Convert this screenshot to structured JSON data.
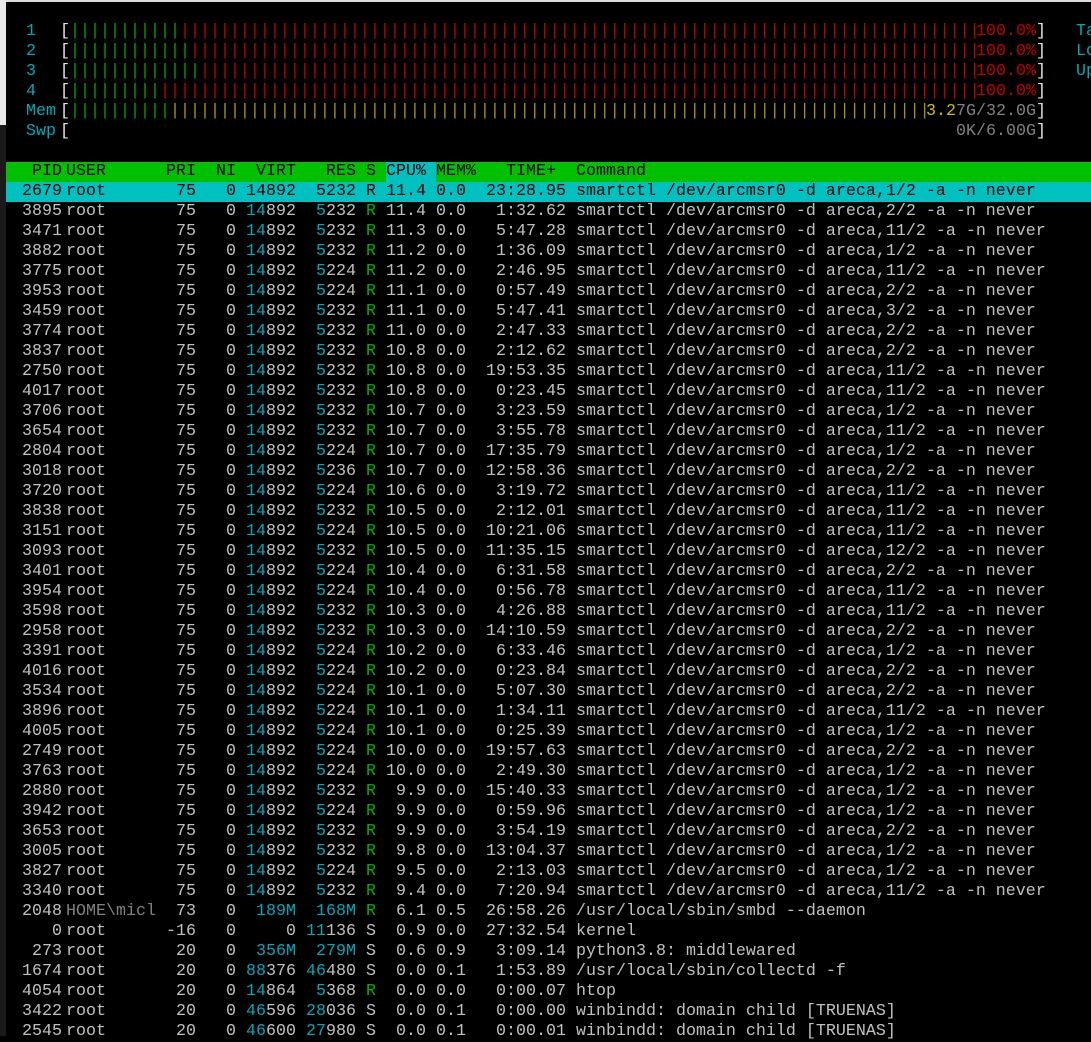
{
  "colors": {
    "header_bg": "#00c000",
    "selected_bg": "#00c0c0",
    "sort_column_bg": "#00c0c0",
    "cpu_normal": "#00a000",
    "cpu_kernel": "#c00000",
    "mem_used": "#00a000",
    "mem_cache": "#a09800",
    "label": "#00a8b8"
  },
  "meters": {
    "cpus": [
      {
        "label": "1",
        "normal_pct": 11.3,
        "kernel_pct": 88.7,
        "value": "100.0%"
      },
      {
        "label": "2",
        "normal_pct": 12.4,
        "kernel_pct": 87.6,
        "value": "100.0%"
      },
      {
        "label": "3",
        "normal_pct": 13.4,
        "kernel_pct": 86.6,
        "value": "100.0%"
      },
      {
        "label": "4",
        "normal_pct": 9.3,
        "kernel_pct": 90.7,
        "value": "100.0%"
      }
    ],
    "mem": {
      "label": "Mem",
      "used_pct": 10.2,
      "cache_pct": 89.8,
      "value_hi": "3.2",
      "value_rest": "7G/32.0G"
    },
    "swp": {
      "label": "Swp",
      "used_pct": 0,
      "value": "0K/6.00G"
    },
    "open_bracket": "[",
    "close_bracket": "]",
    "right_panel": [
      "Ta",
      "Lo",
      "Up"
    ]
  },
  "processes": {
    "columns": {
      "pid": "PID",
      "user": "USER",
      "pri": "PRI",
      "ni": "NI",
      "virt": "VIRT",
      "res": "RES",
      "s": "S",
      "cpu": "CPU%",
      "mem": "MEM%",
      "time": "TIME+",
      "cmd": "Command"
    },
    "sort_column": "CPU%",
    "selected_index": 0,
    "rows": [
      {
        "pid": "2679",
        "user": "root",
        "pri": "75",
        "ni": "0",
        "virt": "14892",
        "res": "5232",
        "s": "R",
        "cpu": "11.4",
        "mem": "0.0",
        "time": "23:28.95",
        "cmd": "smartctl /dev/arcmsr0 -d areca,1/2 -a -n never"
      },
      {
        "pid": "3895",
        "user": "root",
        "pri": "75",
        "ni": "0",
        "virt": "14892",
        "res": "5232",
        "s": "R",
        "cpu": "11.4",
        "mem": "0.0",
        "time": "1:32.62",
        "cmd": "smartctl /dev/arcmsr0 -d areca,2/2 -a -n never"
      },
      {
        "pid": "3471",
        "user": "root",
        "pri": "75",
        "ni": "0",
        "virt": "14892",
        "res": "5232",
        "s": "R",
        "cpu": "11.3",
        "mem": "0.0",
        "time": "5:47.28",
        "cmd": "smartctl /dev/arcmsr0 -d areca,11/2 -a -n never"
      },
      {
        "pid": "3882",
        "user": "root",
        "pri": "75",
        "ni": "0",
        "virt": "14892",
        "res": "5232",
        "s": "R",
        "cpu": "11.2",
        "mem": "0.0",
        "time": "1:36.09",
        "cmd": "smartctl /dev/arcmsr0 -d areca,1/2 -a -n never"
      },
      {
        "pid": "3775",
        "user": "root",
        "pri": "75",
        "ni": "0",
        "virt": "14892",
        "res": "5224",
        "s": "R",
        "cpu": "11.2",
        "mem": "0.0",
        "time": "2:46.95",
        "cmd": "smartctl /dev/arcmsr0 -d areca,11/2 -a -n never"
      },
      {
        "pid": "3953",
        "user": "root",
        "pri": "75",
        "ni": "0",
        "virt": "14892",
        "res": "5224",
        "s": "R",
        "cpu": "11.1",
        "mem": "0.0",
        "time": "0:57.49",
        "cmd": "smartctl /dev/arcmsr0 -d areca,2/2 -a -n never"
      },
      {
        "pid": "3459",
        "user": "root",
        "pri": "75",
        "ni": "0",
        "virt": "14892",
        "res": "5232",
        "s": "R",
        "cpu": "11.1",
        "mem": "0.0",
        "time": "5:47.41",
        "cmd": "smartctl /dev/arcmsr0 -d areca,3/2 -a -n never"
      },
      {
        "pid": "3774",
        "user": "root",
        "pri": "75",
        "ni": "0",
        "virt": "14892",
        "res": "5232",
        "s": "R",
        "cpu": "11.0",
        "mem": "0.0",
        "time": "2:47.33",
        "cmd": "smartctl /dev/arcmsr0 -d areca,2/2 -a -n never"
      },
      {
        "pid": "3837",
        "user": "root",
        "pri": "75",
        "ni": "0",
        "virt": "14892",
        "res": "5232",
        "s": "R",
        "cpu": "10.8",
        "mem": "0.0",
        "time": "2:12.62",
        "cmd": "smartctl /dev/arcmsr0 -d areca,2/2 -a -n never"
      },
      {
        "pid": "2750",
        "user": "root",
        "pri": "75",
        "ni": "0",
        "virt": "14892",
        "res": "5232",
        "s": "R",
        "cpu": "10.8",
        "mem": "0.0",
        "time": "19:53.35",
        "cmd": "smartctl /dev/arcmsr0 -d areca,11/2 -a -n never"
      },
      {
        "pid": "4017",
        "user": "root",
        "pri": "75",
        "ni": "0",
        "virt": "14892",
        "res": "5232",
        "s": "R",
        "cpu": "10.8",
        "mem": "0.0",
        "time": "0:23.45",
        "cmd": "smartctl /dev/arcmsr0 -d areca,11/2 -a -n never"
      },
      {
        "pid": "3706",
        "user": "root",
        "pri": "75",
        "ni": "0",
        "virt": "14892",
        "res": "5232",
        "s": "R",
        "cpu": "10.7",
        "mem": "0.0",
        "time": "3:23.59",
        "cmd": "smartctl /dev/arcmsr0 -d areca,1/2 -a -n never"
      },
      {
        "pid": "3654",
        "user": "root",
        "pri": "75",
        "ni": "0",
        "virt": "14892",
        "res": "5232",
        "s": "R",
        "cpu": "10.7",
        "mem": "0.0",
        "time": "3:55.78",
        "cmd": "smartctl /dev/arcmsr0 -d areca,11/2 -a -n never"
      },
      {
        "pid": "2804",
        "user": "root",
        "pri": "75",
        "ni": "0",
        "virt": "14892",
        "res": "5224",
        "s": "R",
        "cpu": "10.7",
        "mem": "0.0",
        "time": "17:35.79",
        "cmd": "smartctl /dev/arcmsr0 -d areca,1/2 -a -n never"
      },
      {
        "pid": "3018",
        "user": "root",
        "pri": "75",
        "ni": "0",
        "virt": "14892",
        "res": "5236",
        "s": "R",
        "cpu": "10.7",
        "mem": "0.0",
        "time": "12:58.36",
        "cmd": "smartctl /dev/arcmsr0 -d areca,2/2 -a -n never"
      },
      {
        "pid": "3720",
        "user": "root",
        "pri": "75",
        "ni": "0",
        "virt": "14892",
        "res": "5224",
        "s": "R",
        "cpu": "10.6",
        "mem": "0.0",
        "time": "3:19.72",
        "cmd": "smartctl /dev/arcmsr0 -d areca,11/2 -a -n never"
      },
      {
        "pid": "3838",
        "user": "root",
        "pri": "75",
        "ni": "0",
        "virt": "14892",
        "res": "5232",
        "s": "R",
        "cpu": "10.5",
        "mem": "0.0",
        "time": "2:12.01",
        "cmd": "smartctl /dev/arcmsr0 -d areca,11/2 -a -n never"
      },
      {
        "pid": "3151",
        "user": "root",
        "pri": "75",
        "ni": "0",
        "virt": "14892",
        "res": "5224",
        "s": "R",
        "cpu": "10.5",
        "mem": "0.0",
        "time": "10:21.06",
        "cmd": "smartctl /dev/arcmsr0 -d areca,11/2 -a -n never"
      },
      {
        "pid": "3093",
        "user": "root",
        "pri": "75",
        "ni": "0",
        "virt": "14892",
        "res": "5232",
        "s": "R",
        "cpu": "10.5",
        "mem": "0.0",
        "time": "11:35.15",
        "cmd": "smartctl /dev/arcmsr0 -d areca,12/2 -a -n never"
      },
      {
        "pid": "3401",
        "user": "root",
        "pri": "75",
        "ni": "0",
        "virt": "14892",
        "res": "5224",
        "s": "R",
        "cpu": "10.4",
        "mem": "0.0",
        "time": "6:31.58",
        "cmd": "smartctl /dev/arcmsr0 -d areca,2/2 -a -n never"
      },
      {
        "pid": "3954",
        "user": "root",
        "pri": "75",
        "ni": "0",
        "virt": "14892",
        "res": "5224",
        "s": "R",
        "cpu": "10.4",
        "mem": "0.0",
        "time": "0:56.78",
        "cmd": "smartctl /dev/arcmsr0 -d areca,11/2 -a -n never"
      },
      {
        "pid": "3598",
        "user": "root",
        "pri": "75",
        "ni": "0",
        "virt": "14892",
        "res": "5232",
        "s": "R",
        "cpu": "10.3",
        "mem": "0.0",
        "time": "4:26.88",
        "cmd": "smartctl /dev/arcmsr0 -d areca,11/2 -a -n never"
      },
      {
        "pid": "2958",
        "user": "root",
        "pri": "75",
        "ni": "0",
        "virt": "14892",
        "res": "5232",
        "s": "R",
        "cpu": "10.3",
        "mem": "0.0",
        "time": "14:10.59",
        "cmd": "smartctl /dev/arcmsr0 -d areca,2/2 -a -n never"
      },
      {
        "pid": "3391",
        "user": "root",
        "pri": "75",
        "ni": "0",
        "virt": "14892",
        "res": "5224",
        "s": "R",
        "cpu": "10.2",
        "mem": "0.0",
        "time": "6:33.46",
        "cmd": "smartctl /dev/arcmsr0 -d areca,1/2 -a -n never"
      },
      {
        "pid": "4016",
        "user": "root",
        "pri": "75",
        "ni": "0",
        "virt": "14892",
        "res": "5224",
        "s": "R",
        "cpu": "10.2",
        "mem": "0.0",
        "time": "0:23.84",
        "cmd": "smartctl /dev/arcmsr0 -d areca,2/2 -a -n never"
      },
      {
        "pid": "3534",
        "user": "root",
        "pri": "75",
        "ni": "0",
        "virt": "14892",
        "res": "5224",
        "s": "R",
        "cpu": "10.1",
        "mem": "0.0",
        "time": "5:07.30",
        "cmd": "smartctl /dev/arcmsr0 -d areca,2/2 -a -n never"
      },
      {
        "pid": "3896",
        "user": "root",
        "pri": "75",
        "ni": "0",
        "virt": "14892",
        "res": "5224",
        "s": "R",
        "cpu": "10.1",
        "mem": "0.0",
        "time": "1:34.11",
        "cmd": "smartctl /dev/arcmsr0 -d areca,11/2 -a -n never"
      },
      {
        "pid": "4005",
        "user": "root",
        "pri": "75",
        "ni": "0",
        "virt": "14892",
        "res": "5224",
        "s": "R",
        "cpu": "10.1",
        "mem": "0.0",
        "time": "0:25.39",
        "cmd": "smartctl /dev/arcmsr0 -d areca,1/2 -a -n never"
      },
      {
        "pid": "2749",
        "user": "root",
        "pri": "75",
        "ni": "0",
        "virt": "14892",
        "res": "5224",
        "s": "R",
        "cpu": "10.0",
        "mem": "0.0",
        "time": "19:57.63",
        "cmd": "smartctl /dev/arcmsr0 -d areca,2/2 -a -n never"
      },
      {
        "pid": "3763",
        "user": "root",
        "pri": "75",
        "ni": "0",
        "virt": "14892",
        "res": "5224",
        "s": "R",
        "cpu": "10.0",
        "mem": "0.0",
        "time": "2:49.30",
        "cmd": "smartctl /dev/arcmsr0 -d areca,1/2 -a -n never"
      },
      {
        "pid": "2880",
        "user": "root",
        "pri": "75",
        "ni": "0",
        "virt": "14892",
        "res": "5232",
        "s": "R",
        "cpu": "9.9",
        "mem": "0.0",
        "time": "15:40.33",
        "cmd": "smartctl /dev/arcmsr0 -d areca,1/2 -a -n never"
      },
      {
        "pid": "3942",
        "user": "root",
        "pri": "75",
        "ni": "0",
        "virt": "14892",
        "res": "5224",
        "s": "R",
        "cpu": "9.9",
        "mem": "0.0",
        "time": "0:59.96",
        "cmd": "smartctl /dev/arcmsr0 -d areca,1/2 -a -n never"
      },
      {
        "pid": "3653",
        "user": "root",
        "pri": "75",
        "ni": "0",
        "virt": "14892",
        "res": "5232",
        "s": "R",
        "cpu": "9.9",
        "mem": "0.0",
        "time": "3:54.19",
        "cmd": "smartctl /dev/arcmsr0 -d areca,2/2 -a -n never"
      },
      {
        "pid": "3005",
        "user": "root",
        "pri": "75",
        "ni": "0",
        "virt": "14892",
        "res": "5232",
        "s": "R",
        "cpu": "9.8",
        "mem": "0.0",
        "time": "13:04.37",
        "cmd": "smartctl /dev/arcmsr0 -d areca,1/2 -a -n never"
      },
      {
        "pid": "3827",
        "user": "root",
        "pri": "75",
        "ni": "0",
        "virt": "14892",
        "res": "5224",
        "s": "R",
        "cpu": "9.5",
        "mem": "0.0",
        "time": "2:13.03",
        "cmd": "smartctl /dev/arcmsr0 -d areca,1/2 -a -n never"
      },
      {
        "pid": "3340",
        "user": "root",
        "pri": "75",
        "ni": "0",
        "virt": "14892",
        "res": "5232",
        "s": "R",
        "cpu": "9.4",
        "mem": "0.0",
        "time": "7:20.94",
        "cmd": "smartctl /dev/arcmsr0 -d areca,11/2 -a -n never"
      },
      {
        "pid": "2048",
        "user": "HOME\\micl",
        "pri": "73",
        "ni": "0",
        "virt": "189M",
        "res": "168M",
        "s": "R",
        "cpu": "6.1",
        "mem": "0.5",
        "time": "26:58.26",
        "cmd": "/usr/local/sbin/smbd --daemon"
      },
      {
        "pid": "0",
        "user": "root",
        "pri": "-16",
        "ni": "0",
        "virt": "0",
        "res": "11136",
        "s": "S",
        "cpu": "0.9",
        "mem": "0.0",
        "time": "27:32.54",
        "cmd": "kernel"
      },
      {
        "pid": "273",
        "user": "root",
        "pri": "20",
        "ni": "0",
        "virt": "356M",
        "res": "279M",
        "s": "S",
        "cpu": "0.6",
        "mem": "0.9",
        "time": "3:09.14",
        "cmd": "python3.8: middlewared"
      },
      {
        "pid": "1674",
        "user": "root",
        "pri": "20",
        "ni": "0",
        "virt": "88376",
        "res": "46480",
        "s": "S",
        "cpu": "0.0",
        "mem": "0.1",
        "time": "1:53.89",
        "cmd": "/usr/local/sbin/collectd -f"
      },
      {
        "pid": "4054",
        "user": "root",
        "pri": "20",
        "ni": "0",
        "virt": "14864",
        "res": "5368",
        "s": "R",
        "cpu": "0.0",
        "mem": "0.0",
        "time": "0:00.07",
        "cmd": "htop"
      },
      {
        "pid": "3422",
        "user": "root",
        "pri": "20",
        "ni": "0",
        "virt": "46596",
        "res": "28036",
        "s": "S",
        "cpu": "0.0",
        "mem": "0.1",
        "time": "0:00.00",
        "cmd": "winbindd: domain child [TRUENAS]"
      },
      {
        "pid": "2545",
        "user": "root",
        "pri": "20",
        "ni": "0",
        "virt": "46600",
        "res": "27980",
        "s": "S",
        "cpu": "0.0",
        "mem": "0.1",
        "time": "0:00.01",
        "cmd": "winbindd: domain child [TRUENAS]"
      }
    ]
  }
}
